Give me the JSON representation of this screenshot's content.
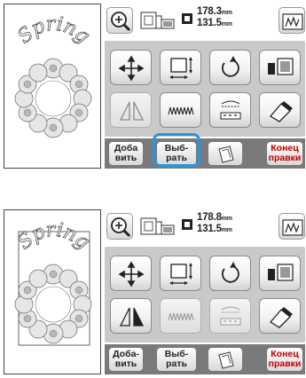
{
  "screens": [
    {
      "preview_text": "Spring",
      "size_width": "178.3",
      "size_height": "131.5",
      "unit": "mm",
      "buttons": {
        "add": "Доба вить",
        "select": "Выб- рать",
        "end_edit": "Конец правки"
      },
      "select_highlighted": true,
      "mirror_enabled": false,
      "density_enabled": true,
      "border_enabled": true
    },
    {
      "preview_text": "Spring",
      "size_width": "178.8",
      "size_height": "131.5",
      "unit": "mm",
      "buttons": {
        "add": "Доба- вить",
        "select": "Выб- рать",
        "end_edit": "Конец правки"
      },
      "select_highlighted": false,
      "mirror_enabled": true,
      "density_enabled": false,
      "border_enabled": false
    }
  ],
  "colors": {
    "highlight": "#2a95e0",
    "end_edit_text": "#c00000",
    "tool_area_bg": "#c9c9c9",
    "bottom_bar_bg": "#7a7a7a"
  },
  "icons": [
    "zoom-icon",
    "hoop-size-icon",
    "size-icon",
    "preview-icon",
    "move-icon",
    "resize-icon",
    "rotate-icon",
    "multi-color-icon",
    "mirror-icon",
    "density-icon",
    "border-icon",
    "array-icon",
    "memory-icon"
  ]
}
